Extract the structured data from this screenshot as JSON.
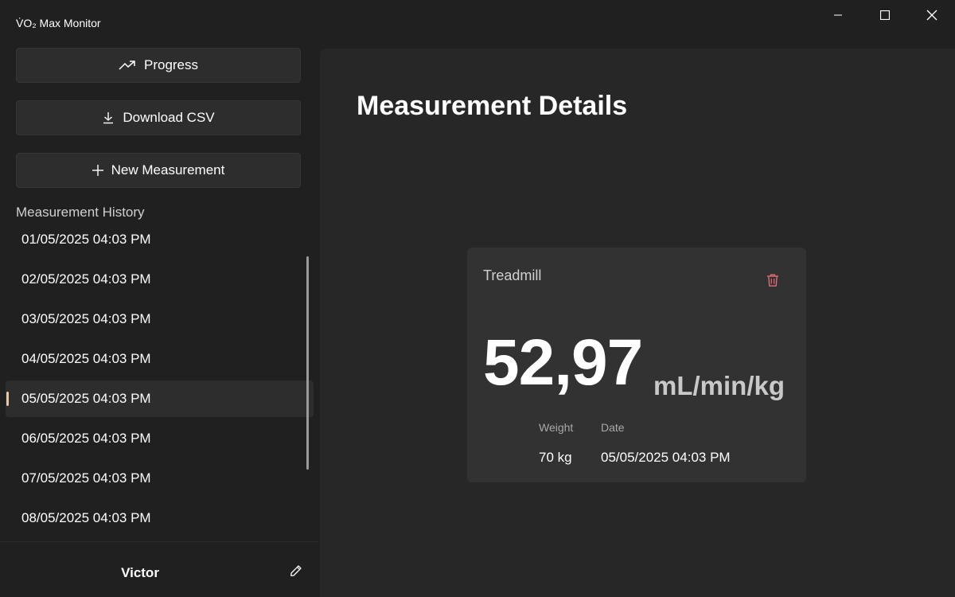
{
  "window": {
    "title": "V̇O₂ Max Monitor",
    "controls": [
      "minimize-icon",
      "maximize-icon",
      "close-icon"
    ]
  },
  "sidebar": {
    "buttons": [
      {
        "label": "Progress",
        "icon": "trending-up-icon"
      },
      {
        "label": "Download CSV",
        "icon": "download-icon"
      },
      {
        "label": "New Measurement",
        "icon": "plus-icon"
      }
    ],
    "history_title": "Measurement History",
    "history": [
      {
        "label": "01/05/2025 04:03 PM",
        "selected": false
      },
      {
        "label": "02/05/2025 04:03 PM",
        "selected": false
      },
      {
        "label": "03/05/2025 04:03 PM",
        "selected": false
      },
      {
        "label": "04/05/2025 04:03 PM",
        "selected": false
      },
      {
        "label": "05/05/2025 04:03 PM",
        "selected": true
      },
      {
        "label": "06/05/2025 04:03 PM",
        "selected": false
      },
      {
        "label": "07/05/2025 04:03 PM",
        "selected": false
      },
      {
        "label": "08/05/2025 04:03 PM",
        "selected": false
      }
    ],
    "user": {
      "name": "Victor",
      "edit_icon": "pencil-icon"
    }
  },
  "main": {
    "title": "Measurement Details",
    "card": {
      "type": "Treadmill",
      "delete_icon": "trash-icon",
      "vo2_value": "52,97",
      "vo2_unit": "mL/min/kg",
      "weight_label": "Weight",
      "weight_value": "70 kg",
      "date_label": "Date",
      "date_value": "05/05/2025 04:03 PM"
    }
  },
  "colors": {
    "background": "#202020",
    "panel": "#272727",
    "card": "#323232",
    "accent_indicator": "#e8c9a6",
    "delete": "#e06c75"
  }
}
